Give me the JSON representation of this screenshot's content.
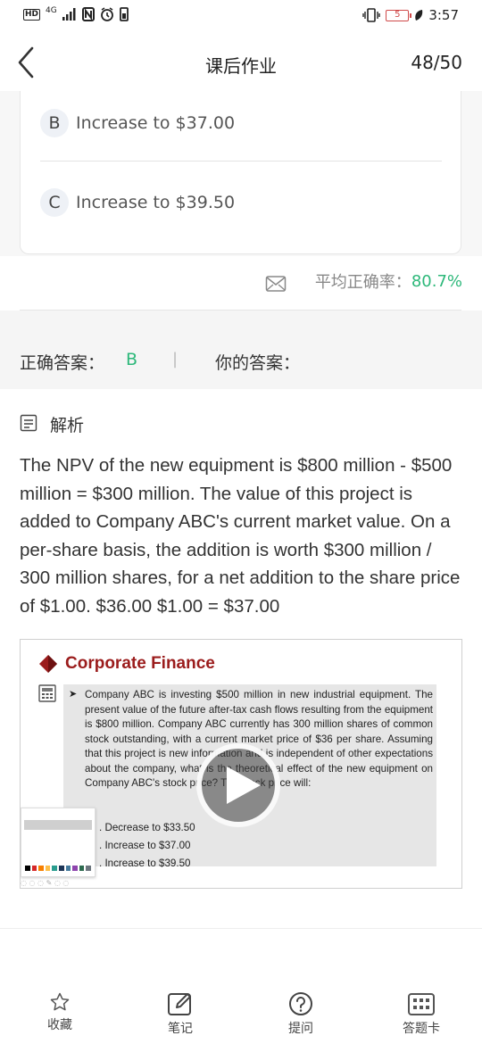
{
  "status_bar": {
    "hd": "HD",
    "network": "4G",
    "battery": "5",
    "time": "3:57"
  },
  "header": {
    "title": "课后作业",
    "counter": "48/50"
  },
  "options": [
    {
      "letter": "B",
      "text": "Increase to $37.00"
    },
    {
      "letter": "C",
      "text": "Increase to $39.50"
    }
  ],
  "stats": {
    "accuracy_label": "平均正确率：",
    "accuracy_value": "80.7%"
  },
  "answer": {
    "correct_label": "正确答案：",
    "correct_value": "B",
    "separator": "|",
    "yours_label": "你的答案：",
    "yours_value": ""
  },
  "analysis": {
    "title": "解析",
    "text": "The NPV of the new equipment is $800 million - $500 million = $300 million. The value of this project is added to Company ABC's current market value. On a per-share basis, the addition is worth $300 million / 300 million shares, for a net addition to the share price of $1.00. $36.00 $1.00 = $37.00"
  },
  "video": {
    "slide_title": "Corporate Finance",
    "question": "Company ABC is investing $500 million in new industrial equipment. The present value of the future after-tax cash flows resulting from the equipment is $800 million. Company ABC currently has 300 million shares of common stock outstanding, with a current market price of $36 per share. Assuming that this project is new information and is independent of other expectations about the company, what is the theoretical effect of the new equipment on Company ABC's stock price? The stock price will:",
    "options": [
      ". Decrease to $33.50",
      ". Increase to $37.00",
      ". Increase to $39.50"
    ],
    "pen_menu_colors": [
      "#000000",
      "#d62828",
      "#f77f00",
      "#fcbf49",
      "#2a9d8f",
      "#1d3557",
      "#457b9d",
      "#8e44ad",
      "#2d6a4f",
      "#6c757d"
    ]
  },
  "bottom_nav": [
    {
      "label": "收藏",
      "icon": "star-icon"
    },
    {
      "label": "笔记",
      "icon": "note-edit-icon"
    },
    {
      "label": "提问",
      "icon": "question-icon"
    },
    {
      "label": "答题卡",
      "icon": "answer-card-icon"
    }
  ],
  "colors": {
    "accent_green": "#2db87a",
    "slide_title_red": "#9b1c1c"
  }
}
